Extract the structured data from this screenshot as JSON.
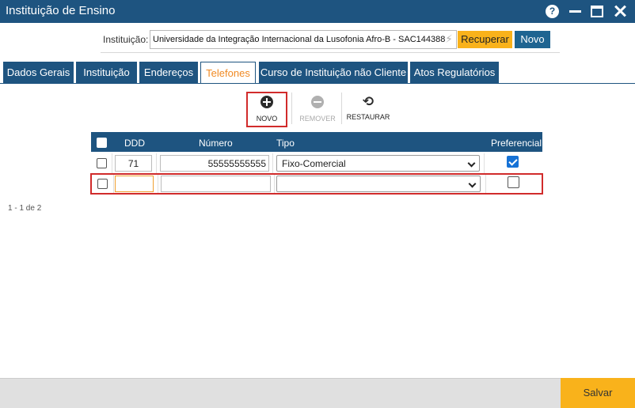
{
  "window": {
    "title": "Instituição de Ensino",
    "help_label": "?"
  },
  "instituicao": {
    "label": "Instituição:",
    "value": "Universidade da Integração Internacional da Lusofonia Afro-B - SAC144388",
    "recuperar_label": "Recuperar",
    "novo_label": "Novo"
  },
  "tabs": [
    {
      "label": "Dados Gerais",
      "active": false
    },
    {
      "label": "Instituição",
      "active": false
    },
    {
      "label": "Endereços",
      "active": false
    },
    {
      "label": "Telefones",
      "active": true
    },
    {
      "label": "Curso de Instituição não Cliente",
      "active": false
    },
    {
      "label": "Atos Regulatórios",
      "active": false
    }
  ],
  "toolbar": {
    "novo_label": "NOVO",
    "remover_label": "REMOVER",
    "restaurar_label": "RESTAURAR"
  },
  "grid": {
    "headers": {
      "ddd": "DDD",
      "numero": "Número",
      "tipo": "Tipo",
      "preferencial": "Preferencial"
    },
    "rows": [
      {
        "ddd": "71",
        "numero": "55555555555",
        "tipo": "Fixo-Comercial",
        "preferencial": true
      },
      {
        "ddd": "",
        "numero": "",
        "tipo": "",
        "preferencial": false
      }
    ]
  },
  "pager": "1 - 1 de 2",
  "footer": {
    "salvar_label": "Salvar"
  },
  "colors": {
    "primary": "#1e5480",
    "accent": "#f9b21b",
    "tab_active_text": "#f08a24",
    "highlight": "#d12b2b"
  }
}
